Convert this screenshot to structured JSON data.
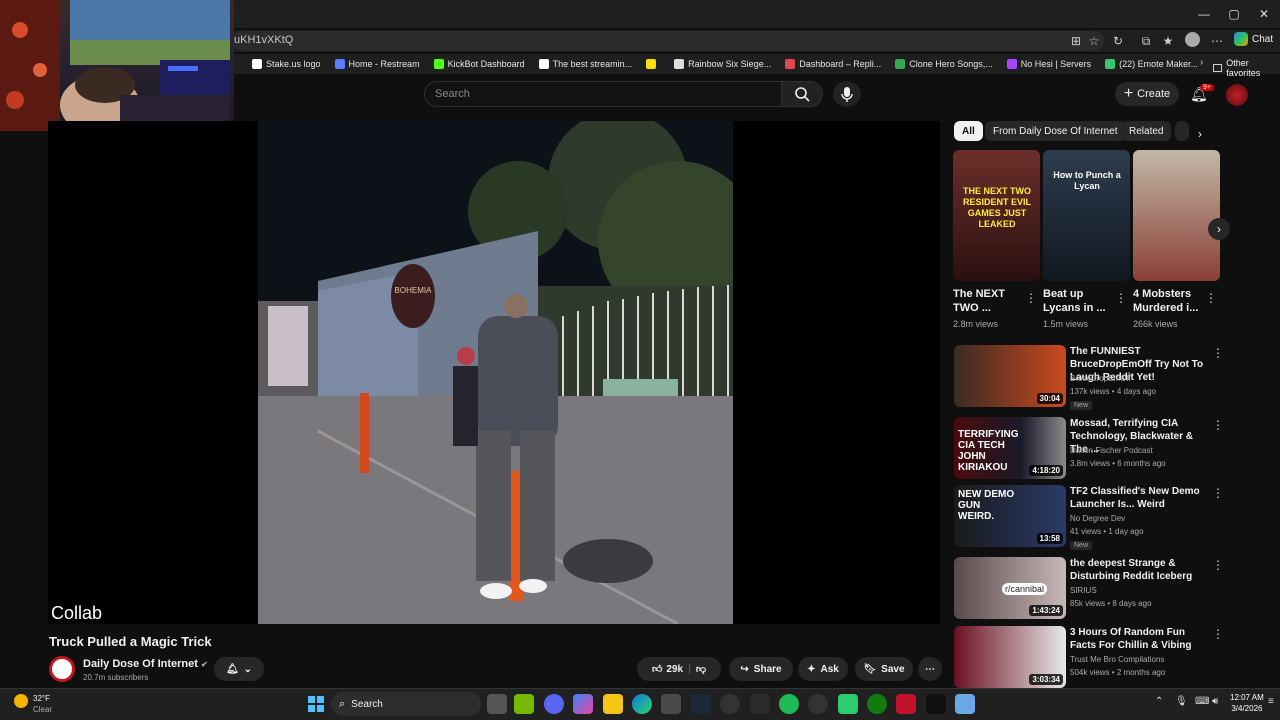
{
  "browser": {
    "url": "uKH1vXKtQ",
    "bookmarks": [
      {
        "label": "Stake.us logo",
        "color": "#ffffff"
      },
      {
        "label": "Home - Restream",
        "color": "#5b7cff"
      },
      {
        "label": "KickBot Dashboard",
        "color": "#53fc18"
      },
      {
        "label": "The best streamin...",
        "color": "#ffffff"
      },
      {
        "label": "",
        "color": "#ffdd00"
      },
      {
        "label": "Rainbow Six Siege...",
        "color": "#dddddd"
      },
      {
        "label": "Dashboard – Repli...",
        "color": "#e0474c"
      },
      {
        "label": "Clone Hero Songs,...",
        "color": "#34a853"
      },
      {
        "label": "No Hesi | Servers",
        "color": "#aa44ff"
      },
      {
        "label": "(22) Emote Maker...",
        "color": "#37c871"
      }
    ],
    "other_favorites": "Other favorites",
    "chat": "Chat"
  },
  "header": {
    "search_placeholder": "Search",
    "create": "Create",
    "notifications": "9+"
  },
  "video": {
    "overlay_text": "Collab",
    "title": "Truck Pulled a Magic Trick",
    "channel": "Daily Dose Of Internet",
    "subscribers": "20.7m subscribers",
    "likes": "29k",
    "share": "Share",
    "ask": "Ask",
    "save": "Save",
    "poster_text": "BOHEMIA PLACE MARKET"
  },
  "chips": [
    "All",
    "From Daily Dose Of Internet",
    "Related"
  ],
  "shorts": [
    {
      "title": "The NEXT TWO ...",
      "views": "2.8m views",
      "thumb_text": "THE NEXT TWO RESIDENT EVIL GAMES JUST LEAKED"
    },
    {
      "title": "Beat up Lycans in ...",
      "views": "1.5m views",
      "thumb_text": "How to Punch a Lycan"
    },
    {
      "title": "4 Mobsters Murdered i...",
      "views": "266k views",
      "thumb_text": ""
    }
  ],
  "recommended": [
    {
      "title": "The FUNNIEST BruceDropEmOff Try Not To Laugh Reddit Yet!",
      "channel": "BruceDropEmOff",
      "meta": "137k views • 4 days ago",
      "duration": "30:04",
      "badge": "New",
      "thumb_text": ""
    },
    {
      "title": "Mossad, Terrifying CIA Technology, Blackwater & The ...",
      "channel": "Dalton Fischer Podcast",
      "meta": "3.8m views • 6 months ago",
      "duration": "4:18:20",
      "badge": "",
      "thumb_text": "TERRIFYING CIA TECH JOHN KIRIAKOU"
    },
    {
      "title": "TF2 Classified's New Demo Launcher Is... Weird",
      "channel": "No Degree Dev",
      "meta": "41 views • 1 day ago",
      "duration": "13:58",
      "badge": "New",
      "thumb_text": "NEW DEMO GUN WEIRD."
    },
    {
      "title": "the deepest Strange & Disturbing Reddit Iceberg",
      "channel": "SIRIUS",
      "meta": "85k views • 8 days ago",
      "duration": "1:43:24",
      "badge": "",
      "thumb_text": "r/cannibal"
    },
    {
      "title": "3 Hours Of Random Fun Facts For Chillin & Vibing",
      "channel": "Trust Me Bro Compilations",
      "meta": "504k views • 2 months ago",
      "duration": "3:03:34",
      "badge": "",
      "thumb_text": ""
    }
  ],
  "taskbar": {
    "weather_temp": "32°F",
    "weather_cond": "Clear",
    "search": "Search",
    "time": "12:07 AM",
    "date": "3/4/2026"
  }
}
